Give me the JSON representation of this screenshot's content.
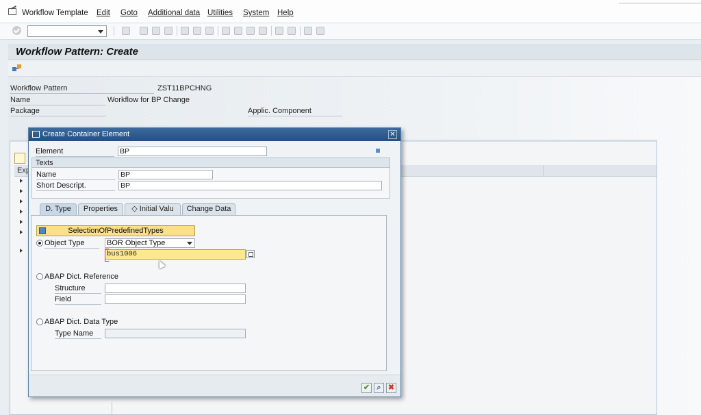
{
  "menubar": {
    "items": [
      "Workflow Template",
      "Edit",
      "Goto",
      "Additional data",
      "Utilities",
      "System",
      "Help"
    ]
  },
  "page": {
    "title": "Workflow Pattern: Create"
  },
  "header": {
    "workflow_pattern_label": "Workflow Pattern",
    "workflow_pattern_value": "ZST11BPCHNG",
    "name_label": "Name",
    "name_value": "Workflow for BP Change",
    "package_label": "Package",
    "applic_component_label": "Applic. Component"
  },
  "background": {
    "column_header": "Exp"
  },
  "dialog": {
    "title": "Create Container Element",
    "element_label": "Element",
    "element_value": "BP",
    "texts_group_title": "Texts",
    "name_label": "Name",
    "name_value": "BP",
    "short_descript_label": "Short Descript.",
    "short_descript_value": "BP",
    "tabs": [
      {
        "label": "D. Type",
        "active": true
      },
      {
        "label": "Properties",
        "active": false
      },
      {
        "label": "◇ Initial Valu",
        "active": false
      },
      {
        "label": "Change Data",
        "active": false
      }
    ],
    "selection_button": "SelectionOfPredefinedTypes",
    "object_type_label": "Object Type",
    "object_type_selected": true,
    "object_type_dropdown": "BOR Object Type",
    "bor_object_value": "bus1006",
    "abap_dict_reference_label": "ABAP Dict. Reference",
    "structure_label": "Structure",
    "field_label": "Field",
    "abap_dict_data_type_label": "ABAP Dict. Data Type",
    "type_name_label": "Type Name",
    "footer_buttons": [
      "confirm",
      "search",
      "cancel"
    ]
  },
  "colors": {
    "dialog_titlebar": "#23507e",
    "highlight_yellow": "#fde88e",
    "confirm_green": "#4e9a2f",
    "cancel_red": "#c83a2a"
  }
}
